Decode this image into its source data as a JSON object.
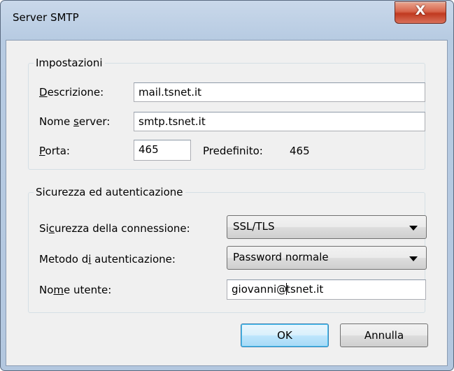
{
  "window": {
    "title": "Server SMTP",
    "close_glyph": "X"
  },
  "settings": {
    "legend": "Impostazioni",
    "description": {
      "label_pre": "",
      "label_key": "D",
      "label_post": "escrizione:",
      "value": "mail.tsnet.it"
    },
    "server_name": {
      "label_pre": "Nome ",
      "label_key": "s",
      "label_post": "erver:",
      "value": "smtp.tsnet.it"
    },
    "port": {
      "label_pre": "",
      "label_key": "P",
      "label_post": "orta:",
      "value": "465"
    },
    "default_port": {
      "label": "Predefinito:",
      "value": "465"
    }
  },
  "security": {
    "legend": "Sicurezza ed autenticazione",
    "connection_security": {
      "label_pre": "Si",
      "label_key": "c",
      "label_post": "urezza della connessione:",
      "value": "SSL/TLS"
    },
    "auth_method": {
      "label_pre": "Metodo d",
      "label_key": "i",
      "label_post": " autenticazione:",
      "value": "Password normale"
    },
    "username": {
      "label_pre": "No",
      "label_key": "m",
      "label_post": "e utente:",
      "value_before_caret": "giovanni@",
      "value_after_caret": "tsnet.it"
    }
  },
  "buttons": {
    "ok": "OK",
    "cancel": "Annulla"
  },
  "icons": {
    "close": "close-icon",
    "dropdown": "chevron-down-icon"
  }
}
